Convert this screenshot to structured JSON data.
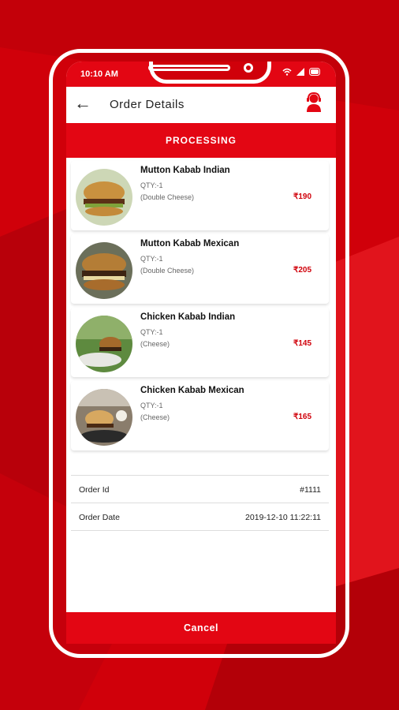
{
  "status_bar": {
    "time": "10:10 AM"
  },
  "header": {
    "title": "Order Details"
  },
  "order_status": "PROCESSING",
  "items": [
    {
      "name": "Mutton Kabab Indian",
      "qty": "QTY:-1",
      "options": "(Double Cheese)",
      "price": "₹190"
    },
    {
      "name": "Mutton Kabab Mexican",
      "qty": "QTY:-1",
      "options": "(Double Cheese)",
      "price": "₹205"
    },
    {
      "name": "Chicken Kabab Indian",
      "qty": "QTY:-1",
      "options": "(Cheese)",
      "price": "₹145"
    },
    {
      "name": "Chicken Kabab Mexican",
      "qty": "QTY:-1",
      "options": "(Cheese)",
      "price": "₹165"
    }
  ],
  "order_info": {
    "id_label": "Order Id",
    "id_value": "#1111",
    "date_label": "Order Date",
    "date_value": "2019-12-10 11:22:11"
  },
  "cancel_label": "Cancel",
  "colors": {
    "brand_red": "#e30613",
    "background_red": "#d0000a"
  }
}
